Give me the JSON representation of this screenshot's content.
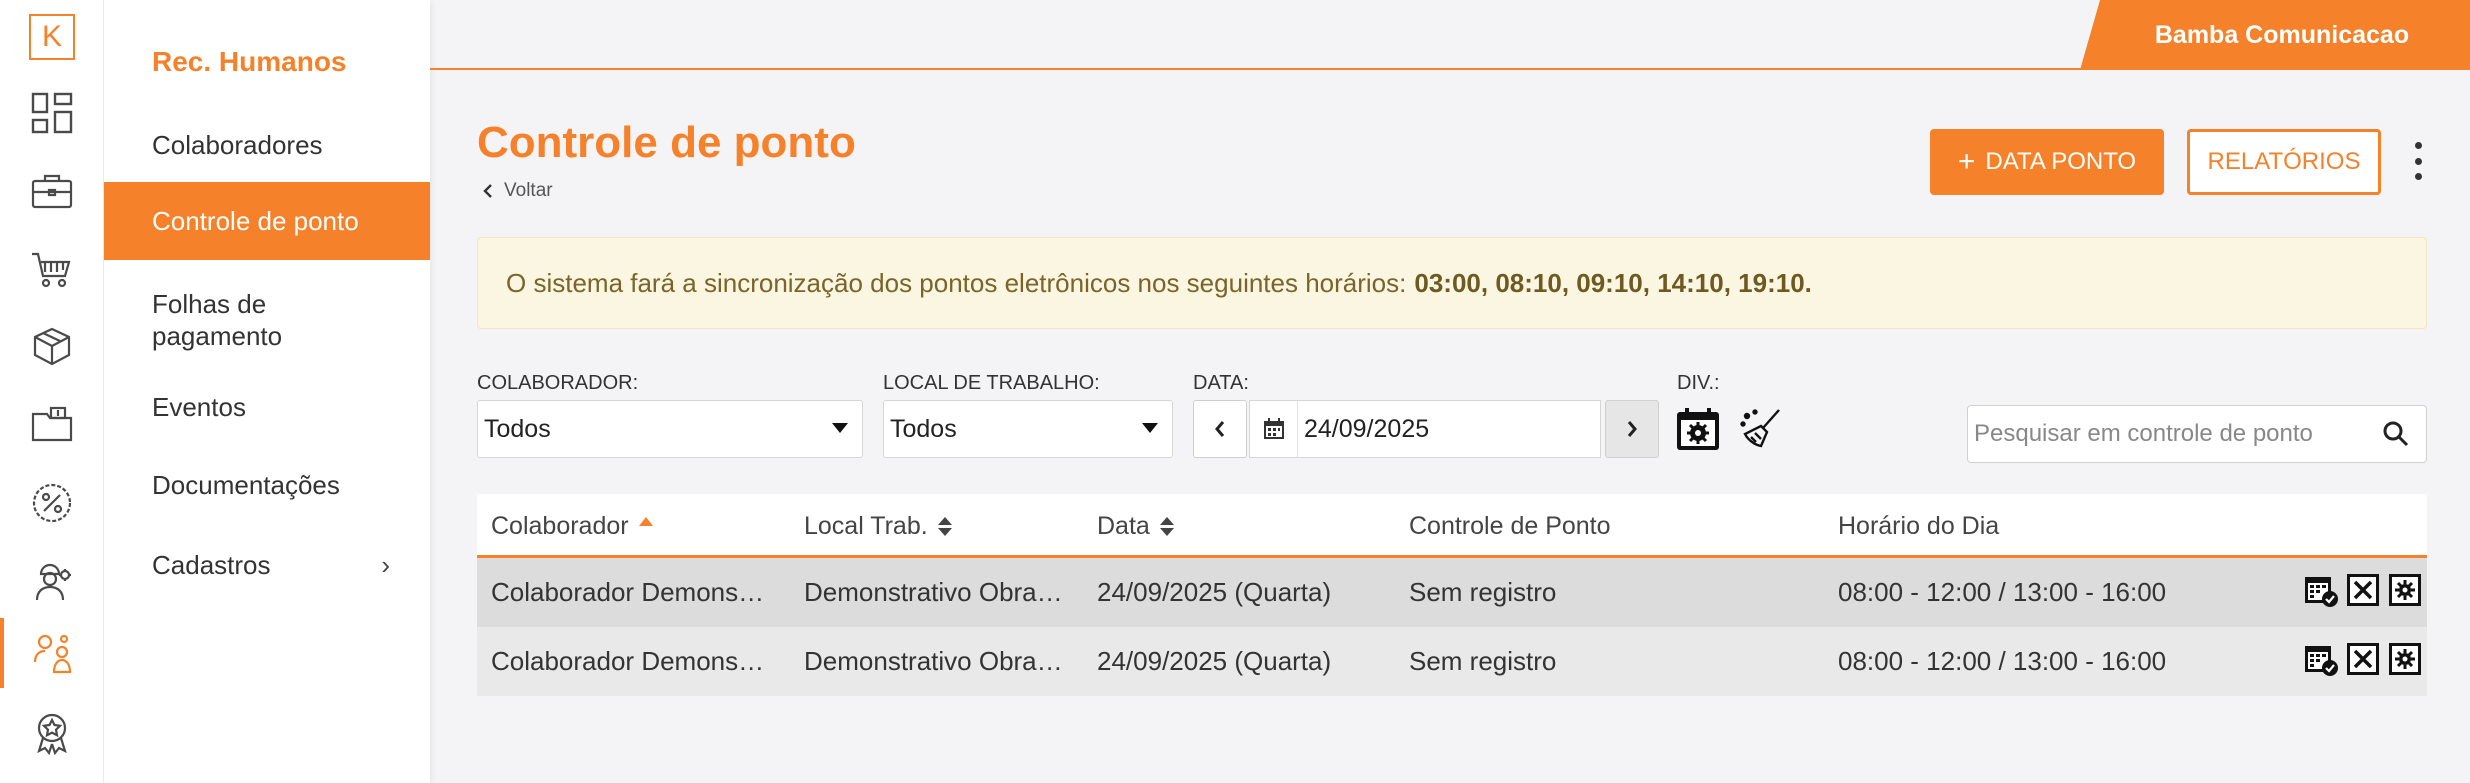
{
  "rail": {
    "logo": "K",
    "icons": [
      "dashboard-icon",
      "briefcase-icon",
      "cart-icon",
      "box-icon",
      "finance-folder-icon",
      "percent-icon",
      "worker-icon",
      "hr-people-icon",
      "award-icon"
    ]
  },
  "sidemenu": {
    "title": "Rec. Humanos",
    "items": [
      {
        "label": "Colaboradores"
      },
      {
        "label": "Controle de ponto"
      },
      {
        "label": "Folhas de pagamento"
      },
      {
        "label": "Eventos"
      },
      {
        "label": "Documentações"
      },
      {
        "label": "Cadastros"
      }
    ]
  },
  "topbar": {
    "company": "Bamba Comunicacao"
  },
  "header": {
    "title": "Controle de ponto",
    "back": "Voltar",
    "btn_add": "DATA PONTO",
    "btn_reports": "RELATÓRIOS"
  },
  "alert": {
    "text": "O sistema fará a sincronização dos pontos eletrônicos nos seguintes horários:",
    "times": "03:00,  08:10,  09:10,  14:10,  19:10."
  },
  "filters": {
    "colaborador_label": "COLABORADOR:",
    "colaborador_value": "Todos",
    "local_label": "LOCAL DE TRABALHO:",
    "local_value": "Todos",
    "data_label": "DATA:",
    "data_value": "24/09/2025",
    "div_label": "DIV.:",
    "search_placeholder": "Pesquisar em controle de ponto"
  },
  "table": {
    "headers": {
      "colaborador": "Colaborador",
      "local": "Local Trab.",
      "data": "Data",
      "controle": "Controle de Ponto",
      "horario": "Horário do Dia"
    },
    "rows": [
      {
        "colaborador": "Colaborador Demons…",
        "local": "Demonstrativo Obra…",
        "data": "24/09/2025 (Quarta)",
        "controle": "Sem registro",
        "horario": "08:00 - 12:00 / 13:00 - 16:00"
      },
      {
        "colaborador": "Colaborador Demons…",
        "local": "Demonstrativo Obra…",
        "data": "24/09/2025 (Quarta)",
        "controle": "Sem registro",
        "horario": "08:00 - 12:00 / 13:00 - 16:00"
      }
    ]
  },
  "colors": {
    "accent": "#f5822a",
    "alert_bg": "#faf6e1"
  }
}
